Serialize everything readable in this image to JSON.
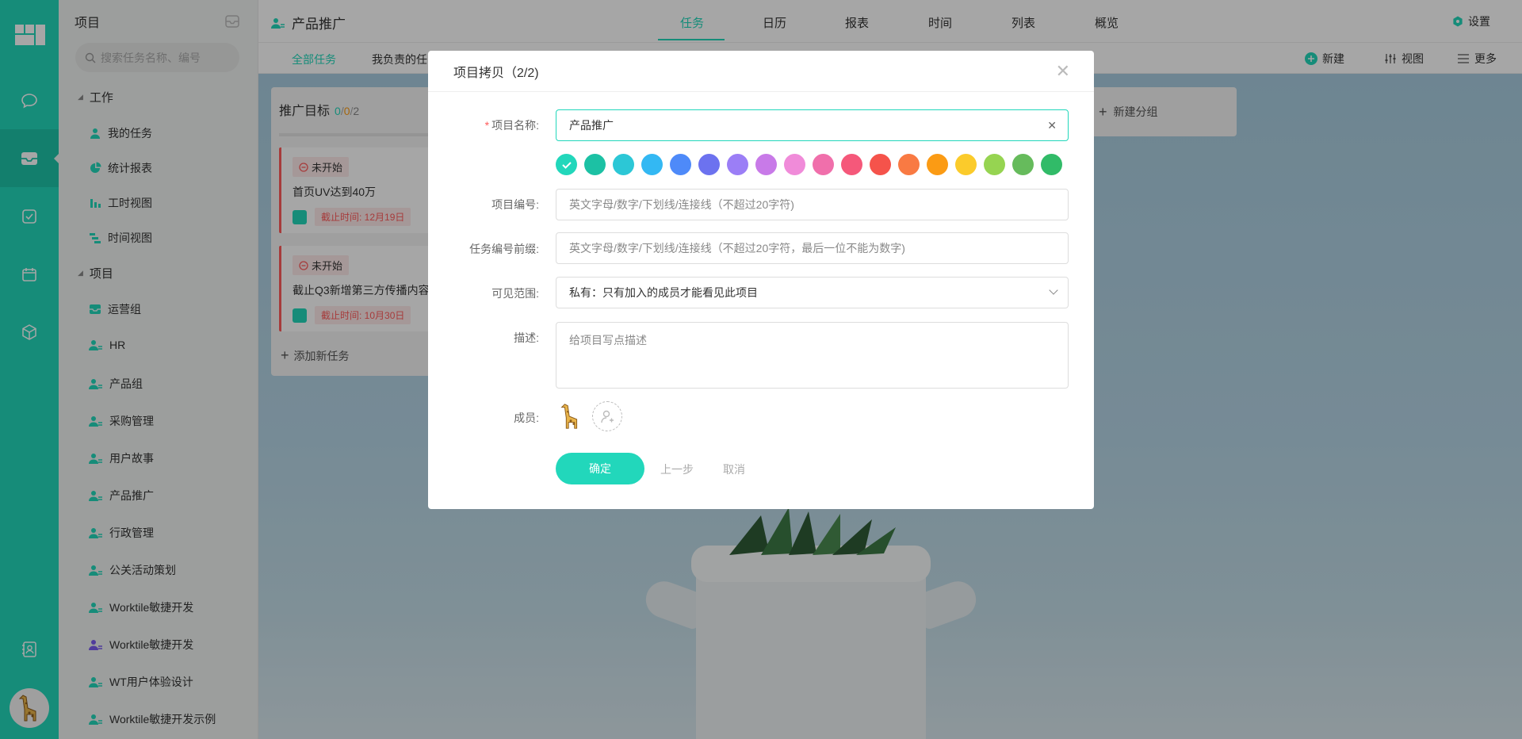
{
  "sidebar": {
    "title": "项目",
    "search_placeholder": "搜索任务名称、编号",
    "groups": [
      {
        "label": "工作"
      },
      {
        "label": "项目"
      }
    ],
    "work_items": [
      {
        "label": "我的任务",
        "icon": "user-icon"
      },
      {
        "label": "统计报表",
        "icon": "pie-chart-icon"
      },
      {
        "label": "工时视图",
        "icon": "bar-chart-icon"
      },
      {
        "label": "时间视图",
        "icon": "timeline-icon"
      }
    ],
    "project_items": [
      {
        "label": "运营组"
      },
      {
        "label": "HR"
      },
      {
        "label": "产品组"
      },
      {
        "label": "采购管理"
      },
      {
        "label": "用户故事"
      },
      {
        "label": "产品推广"
      },
      {
        "label": "行政管理"
      },
      {
        "label": "公关活动策划"
      },
      {
        "label": "Worktile敏捷开发"
      },
      {
        "label": "Worktile敏捷开发"
      },
      {
        "label": "WT用户体验设计"
      },
      {
        "label": "Worktile敏捷开发示例"
      }
    ]
  },
  "header": {
    "project_title": "产品推广",
    "tabs": [
      {
        "label": "任务"
      },
      {
        "label": "日历"
      },
      {
        "label": "报表"
      },
      {
        "label": "时间"
      },
      {
        "label": "列表"
      },
      {
        "label": "概览"
      }
    ],
    "settings_label": "设置"
  },
  "subbar": {
    "tabs": [
      {
        "label": "全部任务"
      },
      {
        "label": "我负责的任"
      }
    ],
    "actions": {
      "new": "新建",
      "view": "视图",
      "more": "更多"
    }
  },
  "board": {
    "column_title": "推广目标",
    "count_done": "0",
    "count_mid": "0",
    "count_total": "2",
    "cards": [
      {
        "status": "未开始",
        "title": "首页UV达到40万",
        "due": "截止时间: 12月19日"
      },
      {
        "status": "未开始",
        "title": "截止Q3新增第三方传播内容",
        "due": "截止时间: 10月30日"
      }
    ],
    "add_task": "添加新任务",
    "new_group": "新建分组"
  },
  "dialog": {
    "title": "项目拷贝（2/2)",
    "fields": {
      "name_label": "项目名称:",
      "name_value": "产品推广",
      "code_label": "项目编号:",
      "code_placeholder": "英文字母/数字/下划线/连接线（不超过20字符)",
      "prefix_label": "任务编号前缀:",
      "prefix_placeholder": "英文字母/数字/下划线/连接线（不超过20字符，最后一位不能为数字)",
      "visibility_label": "可见范围:",
      "visibility_value": "私有：只有加入的成员才能看见此项目",
      "desc_label": "描述:",
      "desc_placeholder": "给项目写点描述",
      "members_label": "成员:"
    },
    "colors": [
      "#22d7bb",
      "#1cc1a4",
      "#2cc7d6",
      "#33b8f3",
      "#4e8af9",
      "#6c72ef",
      "#9b7ef6",
      "#c87ae8",
      "#f08bd9",
      "#f06fab",
      "#f5587a",
      "#f5534b",
      "#f97a43",
      "#fb9b14",
      "#fbcb2b",
      "#96d451",
      "#66bb5c",
      "#31bb68"
    ],
    "selected_color": "#22d7bb",
    "buttons": {
      "confirm": "确定",
      "prev": "上一步",
      "cancel": "取消"
    }
  },
  "theme": {
    "accent": "#22d7bb",
    "danger": "#ff5b5b"
  }
}
